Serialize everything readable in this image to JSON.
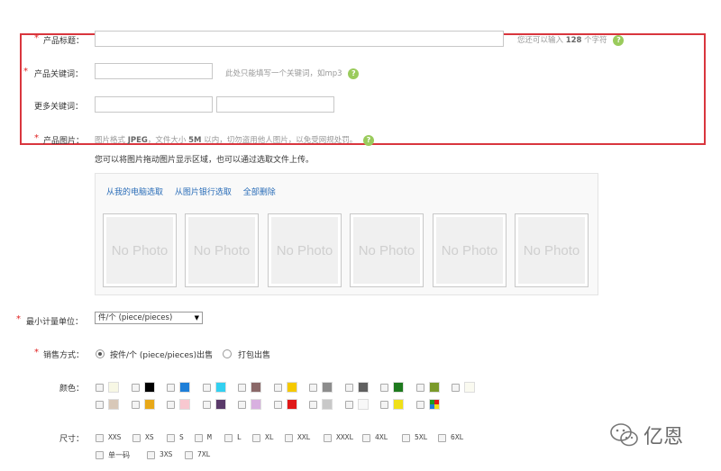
{
  "form": {
    "title": {
      "label": "产品标题：",
      "hint_prefix": "您还可以输入",
      "hint_count": "128",
      "hint_suffix": "个字符"
    },
    "keyword": {
      "label": "产品关键词：",
      "hint": "此处只能填写一个关键词，如mp3"
    },
    "more_keywords": {
      "label": "更多关键词："
    },
    "image": {
      "label": "产品图片：",
      "hint_a": "图片格式",
      "hint_fmt": "JPEG",
      "hint_b": "，文件大小",
      "hint_size": "5M",
      "hint_c": "以内，切勿盗用他人图片，以免受网规处罚。"
    },
    "upload_note": "您可以将图片拖动图片显示区域，也可以通过选取文件上传。",
    "required_mark": "*",
    "help_icon": "?"
  },
  "photos": {
    "links": [
      "从我的电脑选取",
      "从图片银行选取",
      "全部删除"
    ],
    "slots": [
      "No Photo",
      "No Photo",
      "No Photo",
      "No Photo",
      "No Photo",
      "No Photo"
    ]
  },
  "unit": {
    "label": "最小计量单位：",
    "selected": "件/个 (piece/pieces)",
    "arrow": "▼"
  },
  "sale": {
    "label": "销售方式：",
    "options": [
      "按件/个 (piece/pieces)出售",
      "打包出售"
    ],
    "selected_index": 0
  },
  "color": {
    "label": "颜色：",
    "row1": [
      "#f7f7e4",
      "#000000",
      "#1e7fd8",
      "#33d0f0",
      "#8a6868",
      "#f5c900",
      "#8c8c8c",
      "#606060",
      "#1e7a1e",
      "#7a9a2a",
      "#fafaf0"
    ],
    "row2": [
      "#d8c8b8",
      "#e8a818",
      "#f8c8d0",
      "#5a3a6a",
      "#d8b0e0",
      "#e01818",
      "#c8c8c8",
      "#f8f8f8",
      "#f0e018",
      "multicolor"
    ]
  },
  "size": {
    "label": "尺寸：",
    "row1": [
      "XXS",
      "XS",
      "S",
      "M",
      "L",
      "XL",
      "XXL",
      "XXXL",
      "4XL",
      "5XL",
      "6XL"
    ],
    "row2": [
      "单一码",
      "3XS",
      "7XL"
    ]
  },
  "watermark": {
    "text": "亿恩"
  }
}
